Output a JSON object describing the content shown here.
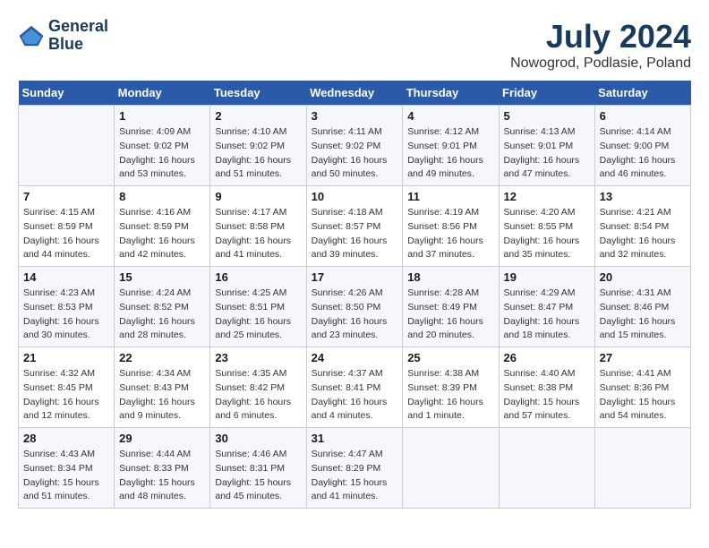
{
  "logo": {
    "name_line1": "General",
    "name_line2": "Blue"
  },
  "header": {
    "month": "July 2024",
    "location": "Nowogrod, Podlasie, Poland"
  },
  "weekdays": [
    "Sunday",
    "Monday",
    "Tuesday",
    "Wednesday",
    "Thursday",
    "Friday",
    "Saturday"
  ],
  "weeks": [
    [
      {
        "day": "",
        "sunrise": "",
        "sunset": "",
        "daylight": ""
      },
      {
        "day": "1",
        "sunrise": "Sunrise: 4:09 AM",
        "sunset": "Sunset: 9:02 PM",
        "daylight": "Daylight: 16 hours and 53 minutes."
      },
      {
        "day": "2",
        "sunrise": "Sunrise: 4:10 AM",
        "sunset": "Sunset: 9:02 PM",
        "daylight": "Daylight: 16 hours and 51 minutes."
      },
      {
        "day": "3",
        "sunrise": "Sunrise: 4:11 AM",
        "sunset": "Sunset: 9:02 PM",
        "daylight": "Daylight: 16 hours and 50 minutes."
      },
      {
        "day": "4",
        "sunrise": "Sunrise: 4:12 AM",
        "sunset": "Sunset: 9:01 PM",
        "daylight": "Daylight: 16 hours and 49 minutes."
      },
      {
        "day": "5",
        "sunrise": "Sunrise: 4:13 AM",
        "sunset": "Sunset: 9:01 PM",
        "daylight": "Daylight: 16 hours and 47 minutes."
      },
      {
        "day": "6",
        "sunrise": "Sunrise: 4:14 AM",
        "sunset": "Sunset: 9:00 PM",
        "daylight": "Daylight: 16 hours and 46 minutes."
      }
    ],
    [
      {
        "day": "7",
        "sunrise": "Sunrise: 4:15 AM",
        "sunset": "Sunset: 8:59 PM",
        "daylight": "Daylight: 16 hours and 44 minutes."
      },
      {
        "day": "8",
        "sunrise": "Sunrise: 4:16 AM",
        "sunset": "Sunset: 8:59 PM",
        "daylight": "Daylight: 16 hours and 42 minutes."
      },
      {
        "day": "9",
        "sunrise": "Sunrise: 4:17 AM",
        "sunset": "Sunset: 8:58 PM",
        "daylight": "Daylight: 16 hours and 41 minutes."
      },
      {
        "day": "10",
        "sunrise": "Sunrise: 4:18 AM",
        "sunset": "Sunset: 8:57 PM",
        "daylight": "Daylight: 16 hours and 39 minutes."
      },
      {
        "day": "11",
        "sunrise": "Sunrise: 4:19 AM",
        "sunset": "Sunset: 8:56 PM",
        "daylight": "Daylight: 16 hours and 37 minutes."
      },
      {
        "day": "12",
        "sunrise": "Sunrise: 4:20 AM",
        "sunset": "Sunset: 8:55 PM",
        "daylight": "Daylight: 16 hours and 35 minutes."
      },
      {
        "day": "13",
        "sunrise": "Sunrise: 4:21 AM",
        "sunset": "Sunset: 8:54 PM",
        "daylight": "Daylight: 16 hours and 32 minutes."
      }
    ],
    [
      {
        "day": "14",
        "sunrise": "Sunrise: 4:23 AM",
        "sunset": "Sunset: 8:53 PM",
        "daylight": "Daylight: 16 hours and 30 minutes."
      },
      {
        "day": "15",
        "sunrise": "Sunrise: 4:24 AM",
        "sunset": "Sunset: 8:52 PM",
        "daylight": "Daylight: 16 hours and 28 minutes."
      },
      {
        "day": "16",
        "sunrise": "Sunrise: 4:25 AM",
        "sunset": "Sunset: 8:51 PM",
        "daylight": "Daylight: 16 hours and 25 minutes."
      },
      {
        "day": "17",
        "sunrise": "Sunrise: 4:26 AM",
        "sunset": "Sunset: 8:50 PM",
        "daylight": "Daylight: 16 hours and 23 minutes."
      },
      {
        "day": "18",
        "sunrise": "Sunrise: 4:28 AM",
        "sunset": "Sunset: 8:49 PM",
        "daylight": "Daylight: 16 hours and 20 minutes."
      },
      {
        "day": "19",
        "sunrise": "Sunrise: 4:29 AM",
        "sunset": "Sunset: 8:47 PM",
        "daylight": "Daylight: 16 hours and 18 minutes."
      },
      {
        "day": "20",
        "sunrise": "Sunrise: 4:31 AM",
        "sunset": "Sunset: 8:46 PM",
        "daylight": "Daylight: 16 hours and 15 minutes."
      }
    ],
    [
      {
        "day": "21",
        "sunrise": "Sunrise: 4:32 AM",
        "sunset": "Sunset: 8:45 PM",
        "daylight": "Daylight: 16 hours and 12 minutes."
      },
      {
        "day": "22",
        "sunrise": "Sunrise: 4:34 AM",
        "sunset": "Sunset: 8:43 PM",
        "daylight": "Daylight: 16 hours and 9 minutes."
      },
      {
        "day": "23",
        "sunrise": "Sunrise: 4:35 AM",
        "sunset": "Sunset: 8:42 PM",
        "daylight": "Daylight: 16 hours and 6 minutes."
      },
      {
        "day": "24",
        "sunrise": "Sunrise: 4:37 AM",
        "sunset": "Sunset: 8:41 PM",
        "daylight": "Daylight: 16 hours and 4 minutes."
      },
      {
        "day": "25",
        "sunrise": "Sunrise: 4:38 AM",
        "sunset": "Sunset: 8:39 PM",
        "daylight": "Daylight: 16 hours and 1 minute."
      },
      {
        "day": "26",
        "sunrise": "Sunrise: 4:40 AM",
        "sunset": "Sunset: 8:38 PM",
        "daylight": "Daylight: 15 hours and 57 minutes."
      },
      {
        "day": "27",
        "sunrise": "Sunrise: 4:41 AM",
        "sunset": "Sunset: 8:36 PM",
        "daylight": "Daylight: 15 hours and 54 minutes."
      }
    ],
    [
      {
        "day": "28",
        "sunrise": "Sunrise: 4:43 AM",
        "sunset": "Sunset: 8:34 PM",
        "daylight": "Daylight: 15 hours and 51 minutes."
      },
      {
        "day": "29",
        "sunrise": "Sunrise: 4:44 AM",
        "sunset": "Sunset: 8:33 PM",
        "daylight": "Daylight: 15 hours and 48 minutes."
      },
      {
        "day": "30",
        "sunrise": "Sunrise: 4:46 AM",
        "sunset": "Sunset: 8:31 PM",
        "daylight": "Daylight: 15 hours and 45 minutes."
      },
      {
        "day": "31",
        "sunrise": "Sunrise: 4:47 AM",
        "sunset": "Sunset: 8:29 PM",
        "daylight": "Daylight: 15 hours and 41 minutes."
      },
      {
        "day": "",
        "sunrise": "",
        "sunset": "",
        "daylight": ""
      },
      {
        "day": "",
        "sunrise": "",
        "sunset": "",
        "daylight": ""
      },
      {
        "day": "",
        "sunrise": "",
        "sunset": "",
        "daylight": ""
      }
    ]
  ]
}
